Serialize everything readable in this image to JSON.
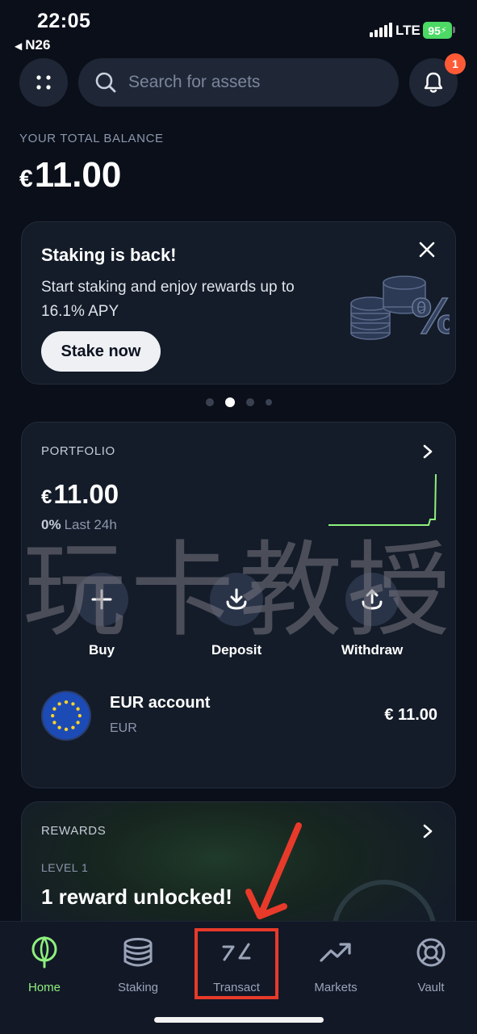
{
  "status_bar": {
    "time": "22:05",
    "back_app": "N26",
    "network": "LTE",
    "battery": "95"
  },
  "search": {
    "placeholder": "Search for assets"
  },
  "notifications": {
    "badge_count": "1"
  },
  "balance": {
    "label": "YOUR TOTAL BALANCE",
    "currency": "€",
    "amount": "11.00"
  },
  "promo": {
    "title": "Staking is back!",
    "description": "Start staking and enjoy rewards up to 16.1% APY",
    "button_label": "Stake now"
  },
  "carousel": {
    "page_count": 4,
    "active_index": 1
  },
  "portfolio": {
    "label": "PORTFOLIO",
    "currency": "€",
    "amount": "11.00",
    "change_pct": "0%",
    "change_period": "Last 24h",
    "actions": [
      {
        "label": "Buy",
        "icon": "plus-icon"
      },
      {
        "label": "Deposit",
        "icon": "download-icon"
      },
      {
        "label": "Withdraw",
        "icon": "upload-icon"
      }
    ],
    "account": {
      "name": "EUR account",
      "code": "EUR",
      "value": "€ 11.00",
      "icon": "eu-flag-icon"
    }
  },
  "rewards": {
    "label": "REWARDS",
    "level": "LEVEL 1",
    "title": "1 reward unlocked!"
  },
  "watermark": "玩卡教授",
  "tabs": [
    {
      "label": "Home",
      "icon": "home-icon",
      "active": true
    },
    {
      "label": "Staking",
      "icon": "coins-stack-icon",
      "active": false
    },
    {
      "label": "Transact",
      "icon": "transact-icon",
      "active": false
    },
    {
      "label": "Markets",
      "icon": "trend-up-icon",
      "active": false
    },
    {
      "label": "Vault",
      "icon": "vault-icon",
      "active": false
    }
  ],
  "colors": {
    "accent_green": "#8ef07e",
    "annotation_red": "#e83a2a",
    "badge_orange": "#ff5a36",
    "background": "#0a0f1a",
    "card": "#141c29"
  }
}
